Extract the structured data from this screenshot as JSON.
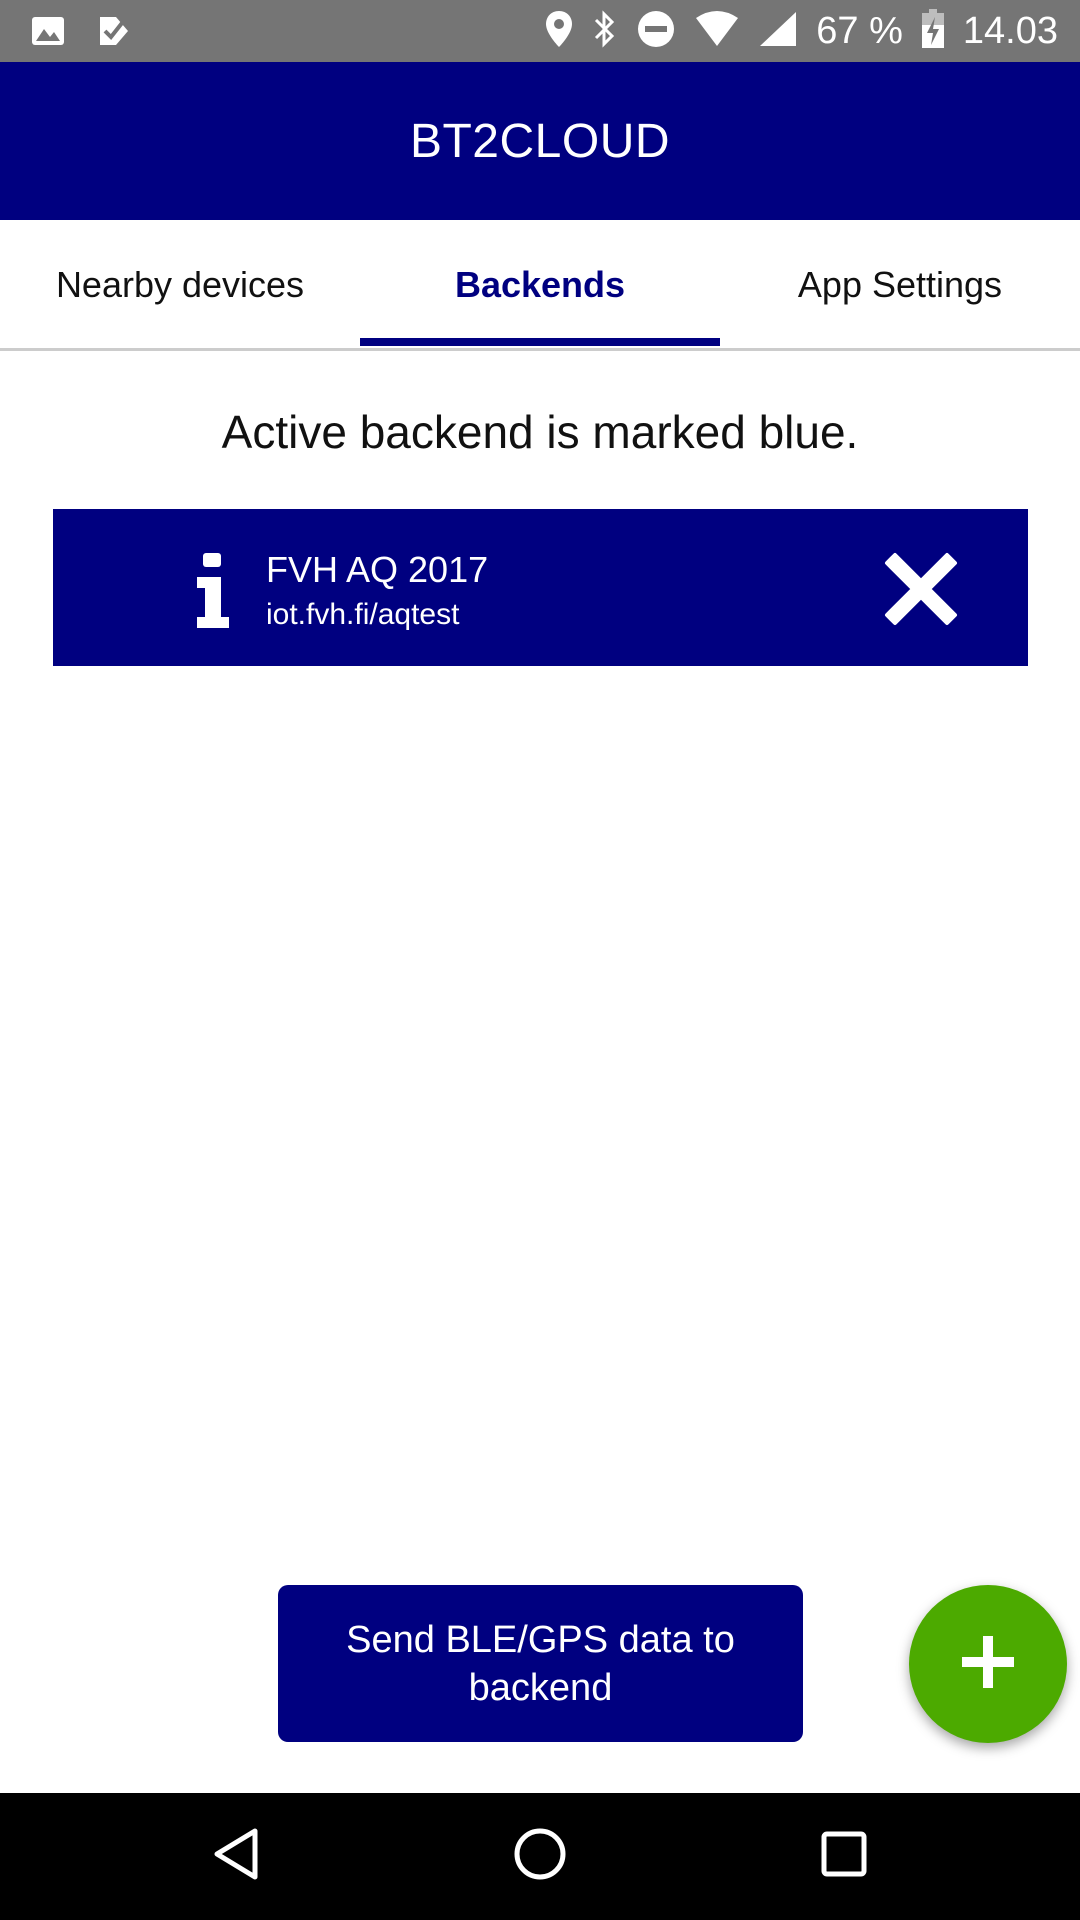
{
  "status_bar": {
    "icons_left": [
      "image-icon",
      "check-app-icon"
    ],
    "icons_right": [
      "location-icon",
      "bluetooth-icon",
      "do-not-disturb-icon",
      "wifi-icon",
      "signal-icon",
      "battery-charging-icon"
    ],
    "battery": "67 %",
    "time": "14.03"
  },
  "app_bar": {
    "title": "BT2CLOUD"
  },
  "tabs": [
    {
      "label": "Nearby devices",
      "active": false
    },
    {
      "label": "Backends",
      "active": true
    },
    {
      "label": "App Settings",
      "active": false
    }
  ],
  "main": {
    "info_text": "Active backend is marked blue.",
    "backends": [
      {
        "name": "FVH AQ 2017",
        "url": "iot.fvh.fi/aqtest",
        "active": true,
        "info_icon": "info-icon",
        "delete_icon": "close-icon"
      }
    ]
  },
  "actions": {
    "send_button": "Send BLE/GPS data to backend",
    "fab_icon": "plus-icon"
  },
  "nav_bar": {
    "buttons": [
      "back-icon",
      "home-icon",
      "recents-icon"
    ]
  },
  "colors": {
    "primary": "#000080",
    "fab": "#4caa00",
    "status_bar": "#757575",
    "nav_bar": "#000000"
  }
}
